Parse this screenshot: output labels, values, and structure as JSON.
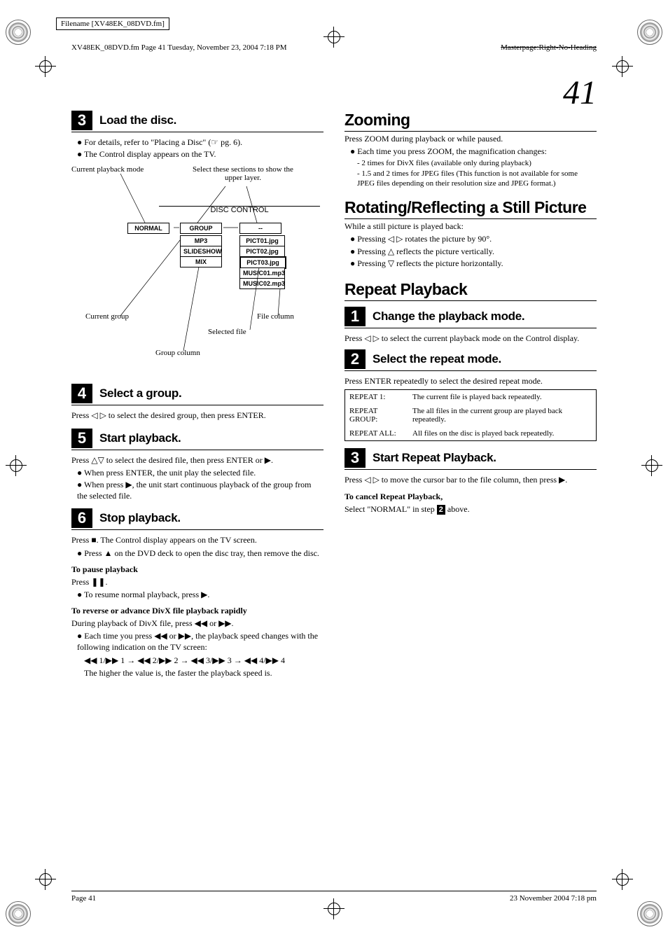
{
  "meta": {
    "filename_label": "Filename [XV48EK_08DVD.fm]",
    "header_left": "XV48EK_08DVD.fm  Page 41  Tuesday, November 23, 2004  7:18 PM",
    "header_right": "Masterpage:Right-No-Heading",
    "page_big_num": "41",
    "footer_left": "Page 41",
    "footer_right": "23 November 2004 7:18 pm"
  },
  "left": {
    "step3": {
      "num": "3",
      "title": "Load the disc.",
      "b1": "For details, refer to \"Placing a Disc\" (☞ pg. 6).",
      "b2": "The Control display appears on the TV."
    },
    "diagram": {
      "label_playmode": "Current playback mode",
      "label_sections": "Select these sections to show the upper layer.",
      "title": "DISC CONTROL",
      "normal": "NORMAL",
      "group": "GROUP",
      "dash": "--",
      "mp3": "MP3",
      "slideshow": "SLIDESHOW",
      "mix": "MIX",
      "f1": "PICT01.jpg",
      "f2": "PICT02.jpg",
      "f3": "PICT03.jpg",
      "f4": "MUSIC01.mp3",
      "f5": "MUSIC02.mp3",
      "label_curgroup": "Current group",
      "label_filecol": "File column",
      "label_selfile": "Selected file",
      "label_groupcol": "Group column"
    },
    "step4": {
      "num": "4",
      "title": "Select a group.",
      "body": "Press ◁ ▷ to select the desired group, then press ENTER."
    },
    "step5": {
      "num": "5",
      "title": "Start playback.",
      "body": "Press △▽ to select the desired file, then press ENTER or ▶.",
      "b1": "When press ENTER, the unit play the selected file.",
      "b2": "When press ▶, the unit start continuous playback of the group from the selected file."
    },
    "step6": {
      "num": "6",
      "title": "Stop playback.",
      "body": "Press ■. The Control display appears on the TV screen.",
      "b1": "Press ▲ on the DVD deck to open the disc tray, then remove the disc.",
      "pause_title": "To pause playback",
      "pause_body": "Press ❚❚.",
      "pause_b1": "To resume normal playback, press ▶.",
      "rev_title": "To reverse or advance DivX file playback rapidly",
      "rev_body": "During playback of DivX file, press ◀◀ or ▶▶.",
      "rev_b1": "Each time you press ◀◀ or ▶▶, the playback speed changes with the following indication on the TV screen:",
      "rev_seq": "◀◀ 1/▶▶ 1 → ◀◀ 2/▶▶ 2 → ◀◀ 3/▶▶ 3 → ◀◀ 4/▶▶ 4",
      "rev_note": "The higher the value is, the faster the playback speed is."
    }
  },
  "right": {
    "zoom": {
      "heading": "Zooming",
      "body": "Press ZOOM during playback or while paused.",
      "b1": "Each time you press ZOOM, the magnification changes:",
      "s1": "- 2 times for DivX files (available only during playback)",
      "s2": "- 1.5 and 2 times for JPEG files (This function is not available for some JPEG files depending on their resolution size and JPEG format.)"
    },
    "rotate": {
      "heading": "Rotating/Reflecting a Still Picture",
      "body": "While a still picture is played back:",
      "b1": "Pressing ◁ ▷ rotates the picture by 90°.",
      "b2": "Pressing △ reflects the picture vertically.",
      "b3": "Pressing ▽ reflects the picture horizontally."
    },
    "repeat": {
      "heading": "Repeat Playback",
      "step1": {
        "num": "1",
        "title": "Change the playback mode.",
        "body": "Press ◁ ▷ to select the current playback mode on the Control display."
      },
      "step2": {
        "num": "2",
        "title": "Select the repeat mode.",
        "body": "Press ENTER repeatedly to select the desired repeat mode."
      },
      "table": {
        "r1l": "REPEAT 1:",
        "r1r": "The current file is played back repeatedly.",
        "r2l": "REPEAT GROUP:",
        "r2r": "The all files in the current group are played back repeatedly.",
        "r3l": "REPEAT ALL:",
        "r3r": "All files on the disc is played back repeatedly."
      },
      "step3": {
        "num": "3",
        "title": "Start Repeat Playback.",
        "body": "Press ◁ ▷ to move the cursor bar to the file column, then press ▶."
      },
      "cancel_title": "To cancel Repeat Playback,",
      "cancel_body_a": "Select \"NORMAL\" in step ",
      "cancel_body_b": "2",
      "cancel_body_c": " above."
    }
  }
}
